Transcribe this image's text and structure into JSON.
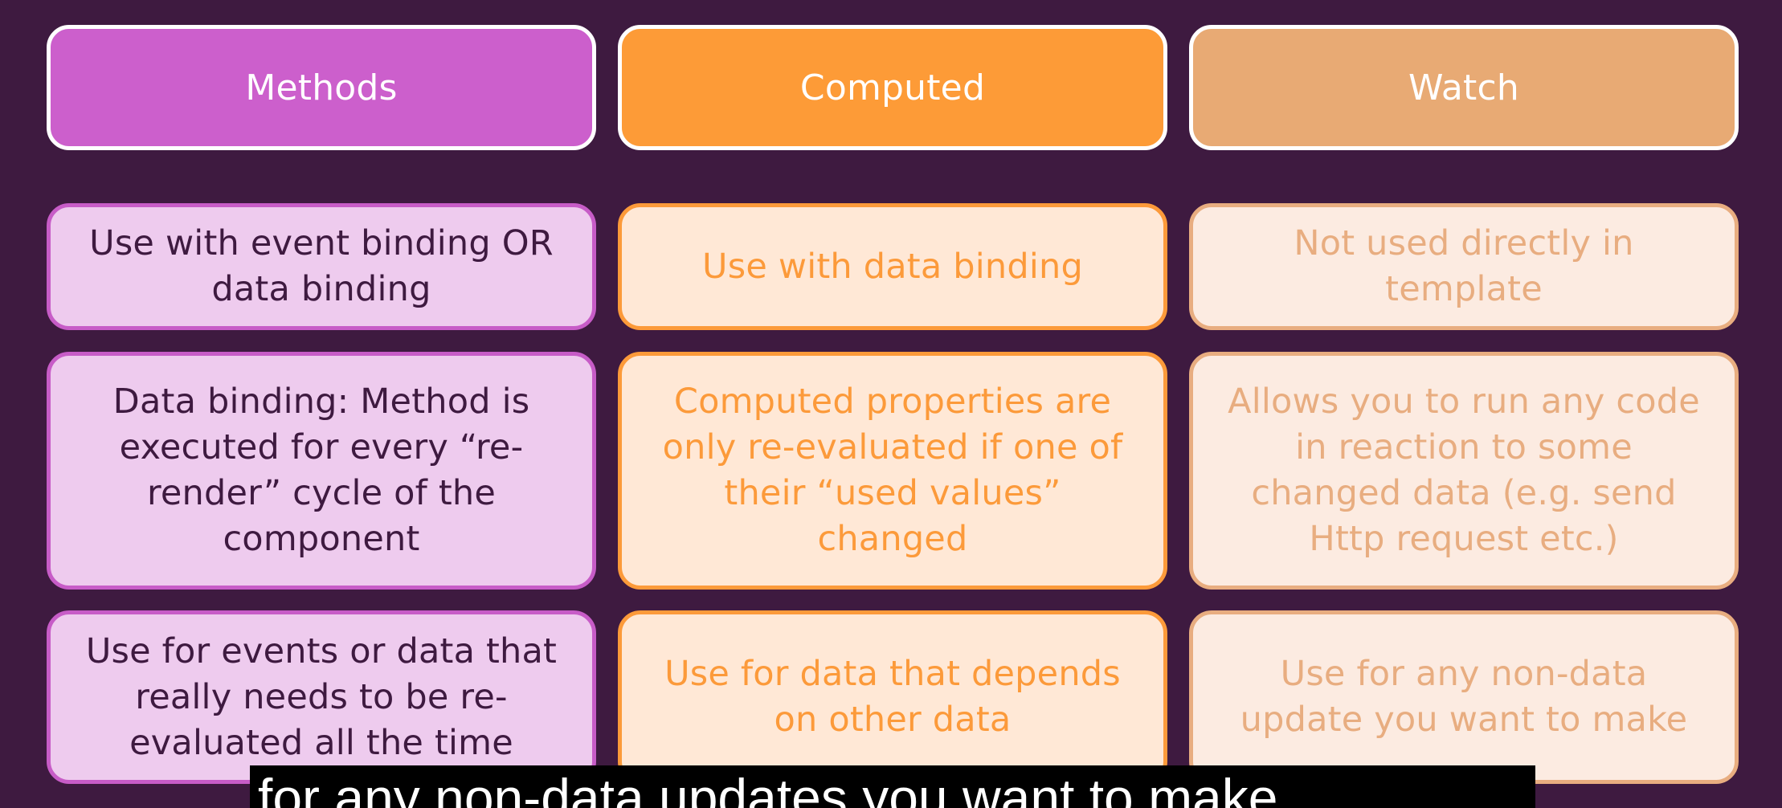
{
  "columns": [
    {
      "header": "Methods",
      "rows": [
        "Use with event binding OR data binding",
        "Data binding: Method is executed for every “re-render” cycle of the component",
        "Use for events or data that really needs to be re-evaluated all the time"
      ]
    },
    {
      "header": "Computed",
      "rows": [
        "Use with data binding",
        "Computed properties are only re-evaluated if one of their “used values” changed",
        "Use for data that depends on other data"
      ]
    },
    {
      "header": "Watch",
      "rows": [
        "Not used directly in template",
        "Allows you to run any code in reaction to some changed data (e.g. send Http request etc.)",
        "Use for any non-data update you want to make"
      ]
    }
  ],
  "caption": "for any non-data updates you want to make",
  "colors": {
    "background": "#3e1a40",
    "methods": "#cc5fcc",
    "computed": "#fd9b37",
    "watch": "#e8aa74"
  }
}
